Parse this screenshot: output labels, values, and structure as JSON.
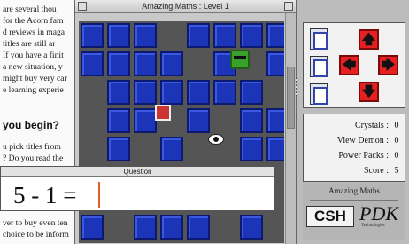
{
  "article": {
    "lines": [
      "are several thou",
      "for the Acorn fam",
      "d reviews in maga",
      "titles are still ar",
      "If you have a finit",
      "a new situation, y",
      "might buy very car",
      "e learning experie"
    ],
    "heading": "you begin?",
    "lines2": [
      "u pick titles from",
      "? Do you read the"
    ],
    "lines3": [
      "ver to buy even ten",
      "choice to be inform"
    ]
  },
  "game": {
    "window_title": "Amazing Maths : Level 1",
    "question": {
      "title": "Question",
      "text": "5 - 1 =",
      "answer": ""
    }
  },
  "panel": {
    "controls": {
      "up_arrow": "🡅",
      "left_arrow": "🡄",
      "right_arrow": "🡆",
      "down_arrow": "🡇",
      "icon_names": [
        "document-icon",
        "sound-icon",
        "pause-icon"
      ]
    },
    "stats": [
      {
        "label": "Crystals :",
        "value": "0"
      },
      {
        "label": "View Demon :",
        "value": "0"
      },
      {
        "label": "Power Packs :",
        "value": "0"
      },
      {
        "label": "Score :",
        "value": "5"
      }
    ],
    "brand": {
      "name": "Amazing Maths",
      "logo_left": "CSH",
      "logo_right": "PDK",
      "logo_right_sub": "Technologies"
    }
  },
  "colors": {
    "tile_blue": "#1c34b8",
    "arrow_red": "#e52020"
  }
}
